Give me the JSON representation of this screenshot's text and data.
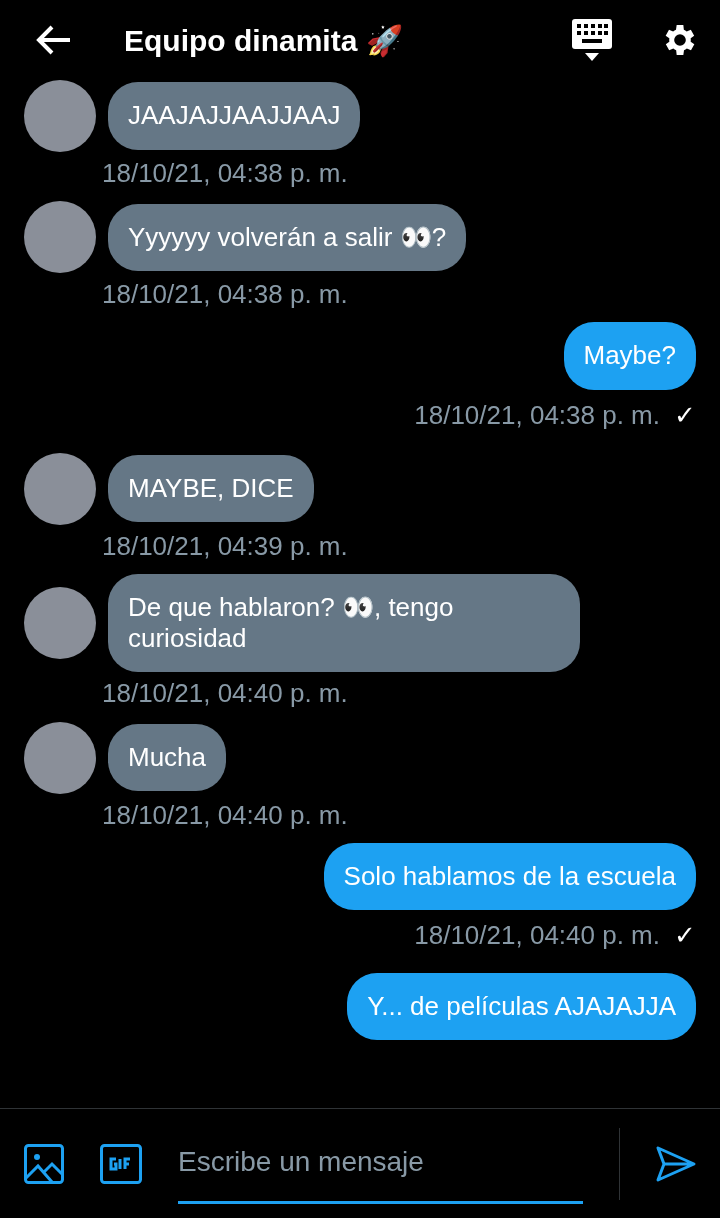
{
  "header": {
    "title": "Equipo dinamita 🚀"
  },
  "messages": [
    {
      "kind": "received",
      "text": "JAAJAJJAAJJAAJ",
      "time": "18/10/21, 04:38 p. m.",
      "avatar": true
    },
    {
      "kind": "received",
      "text": "Yyyyyy volverán a salir 👀?",
      "time": "18/10/21, 04:38 p. m.",
      "avatar": true
    },
    {
      "kind": "sent",
      "text": "Maybe?",
      "time": "18/10/21, 04:38 p. m.",
      "status": "✓"
    },
    {
      "kind": "received",
      "text": "MAYBE, DICE",
      "time": "18/10/21, 04:39 p. m.",
      "avatar": true
    },
    {
      "kind": "received",
      "text": "De que hablaron? 👀, tengo curiosidad",
      "time": "18/10/21, 04:40 p. m.",
      "avatar": true
    },
    {
      "kind": "received",
      "text": "Mucha",
      "time": "18/10/21, 04:40 p. m.",
      "avatar": true
    },
    {
      "kind": "sent",
      "text": "Solo hablamos de la escuela",
      "time": "18/10/21, 04:40 p. m.",
      "status": "✓"
    },
    {
      "kind": "sent",
      "text": "Y... de películas AJAJAJJA"
    }
  ],
  "composer": {
    "placeholder": "Escribe un mensaje"
  }
}
